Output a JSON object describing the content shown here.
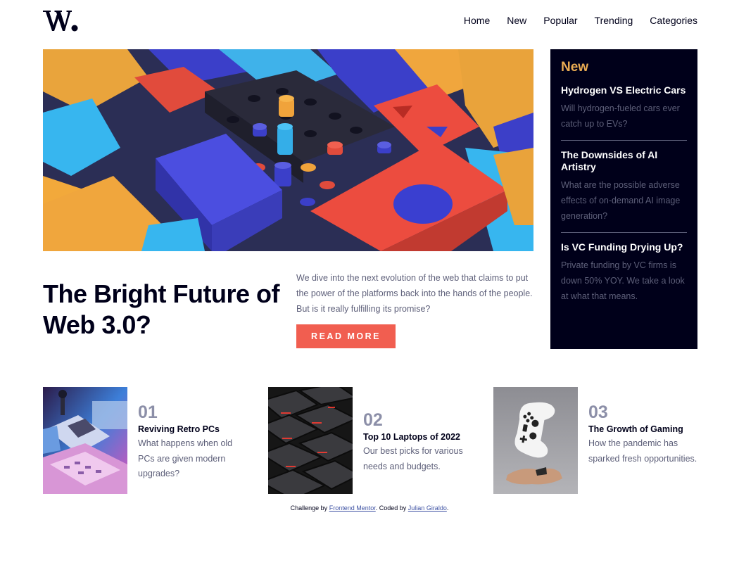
{
  "header": {
    "logo_text": "W.",
    "nav": [
      "Home",
      "New",
      "Popular",
      "Trending",
      "Categories"
    ]
  },
  "hero": {
    "image_icon": "hero-3d-blocks-image",
    "title": "The Bright Future of Web 3.0?",
    "description": "We dive into the next evolution of the web that claims to put the power of the platforms back into the hands of the people. But is it really fulfilling its promise?",
    "cta_label": "READ MORE"
  },
  "new_panel": {
    "heading": "New",
    "items": [
      {
        "title": "Hydrogen VS Electric Cars",
        "description": "Will hydrogen-fueled cars ever catch up to EVs?"
      },
      {
        "title": "The Downsides of AI Artistry",
        "description": "What are the possible adverse effects of on-demand AI image generation?"
      },
      {
        "title": "Is VC Funding Drying Up?",
        "description": "Private funding by VC firms is down 50% YOY. We take a look at what that means."
      }
    ]
  },
  "cards": [
    {
      "number": "01",
      "title": "Reviving Retro PCs",
      "description": "What happens when old PCs are given modern upgrades?",
      "image_icon": "retro-pc-image"
    },
    {
      "number": "02",
      "title": "Top 10 Laptops of 2022",
      "description": "Our best picks for various needs and budgets.",
      "image_icon": "keyboard-image"
    },
    {
      "number": "03",
      "title": "The Growth of Gaming",
      "description": "How the pandemic has sparked fresh opportunities.",
      "image_icon": "gamepad-image"
    }
  ],
  "attribution": {
    "prefix": "Challenge by",
    "link1": "Frontend Mentor",
    "middle": ". Coded by",
    "link2": "Julian Giraldo",
    "suffix": "."
  },
  "colors": {
    "soft_orange": "#e9ab53",
    "soft_red": "#f15e50",
    "very_dark_blue": "#00001a",
    "grayish_blue": "#5d5f79",
    "dark_grayish_blue": "#8c8fa8"
  }
}
